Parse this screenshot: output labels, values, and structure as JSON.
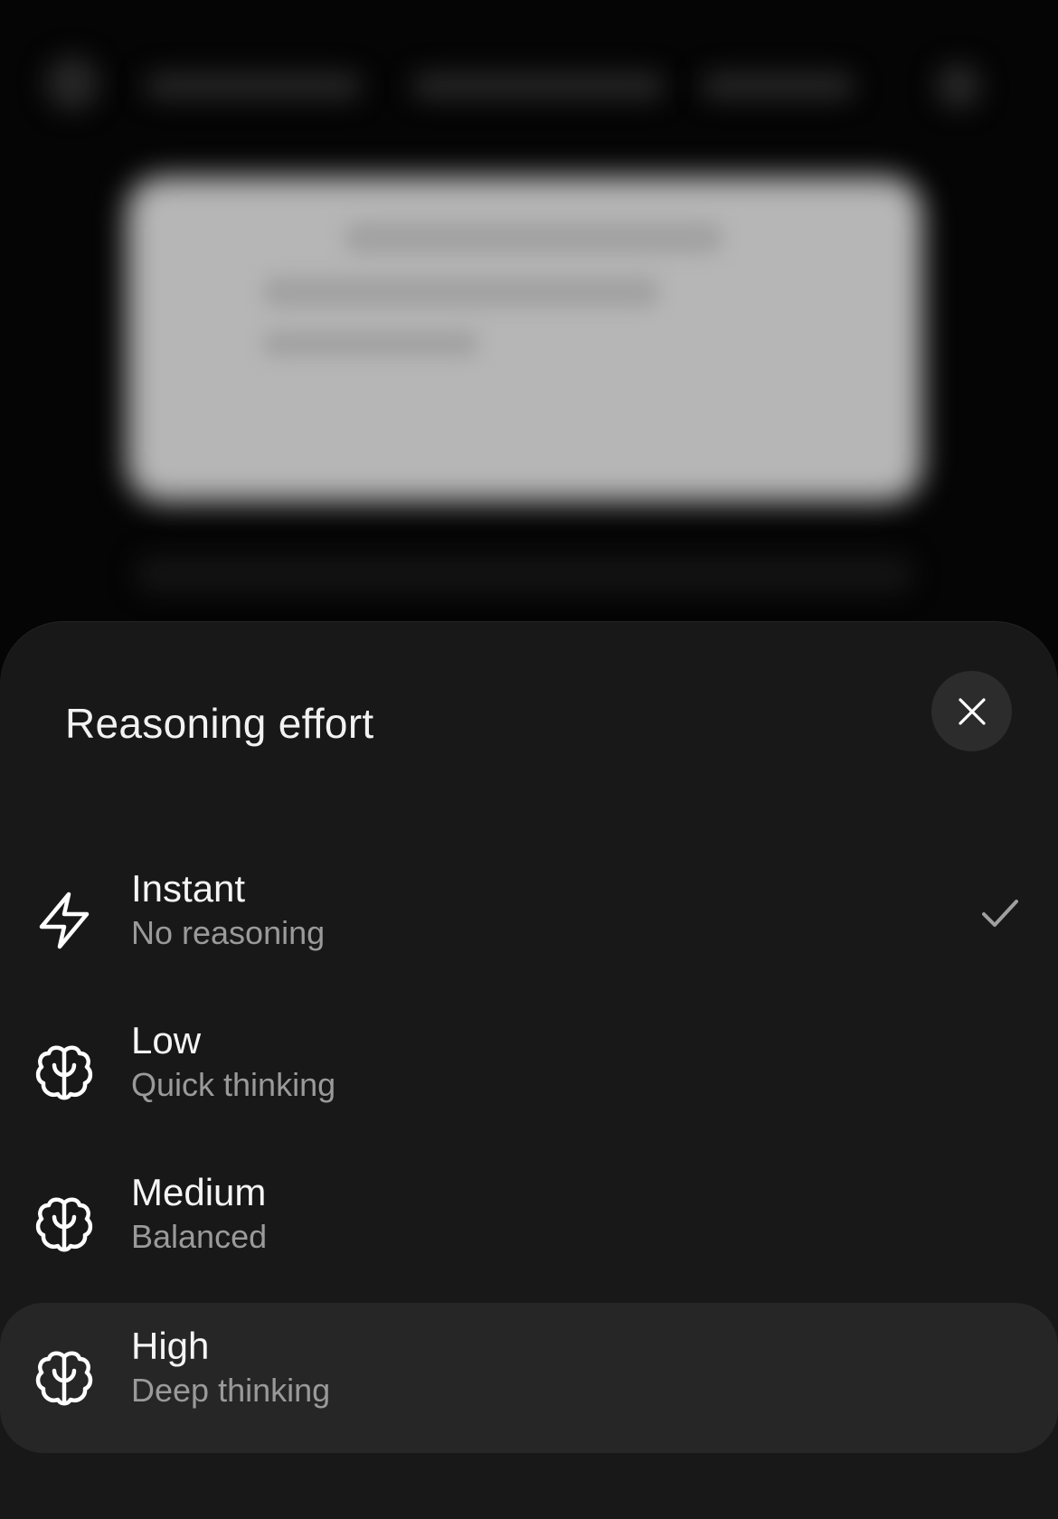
{
  "sheet": {
    "title": "Reasoning effort",
    "close_icon": "close-icon"
  },
  "options": [
    {
      "label": "Instant",
      "subtitle": "No reasoning",
      "icon": "lightning-icon",
      "selected": true,
      "highlighted": false
    },
    {
      "label": "Low",
      "subtitle": "Quick thinking",
      "icon": "brain-icon",
      "selected": false,
      "highlighted": false
    },
    {
      "label": "Medium",
      "subtitle": "Balanced",
      "icon": "brain-icon",
      "selected": false,
      "highlighted": false
    },
    {
      "label": "High",
      "subtitle": "Deep thinking",
      "icon": "brain-icon",
      "selected": false,
      "highlighted": true
    }
  ],
  "colors": {
    "sheet_background": "#181818",
    "highlight_row": "#262626",
    "subtitle_text": "#9a9a9a",
    "checkmark": "#a0a0a0"
  }
}
